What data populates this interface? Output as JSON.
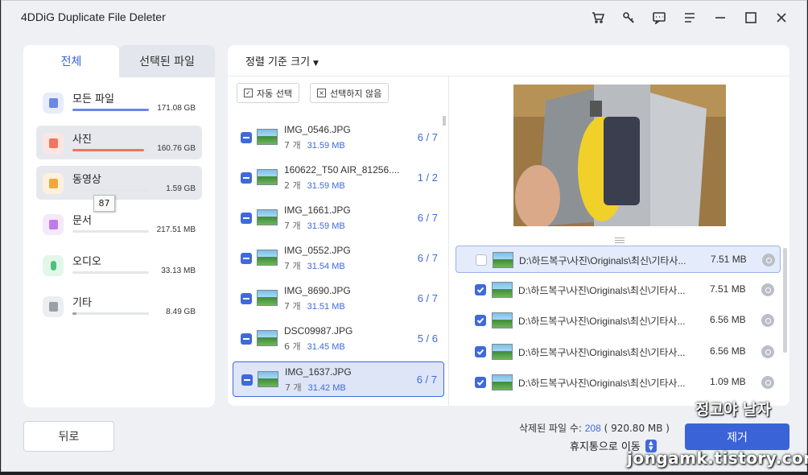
{
  "window": {
    "title": "4DDiG Duplicate File Deleter"
  },
  "left": {
    "tabs": [
      {
        "label": "전체"
      },
      {
        "label": "선택된 파일"
      }
    ],
    "categories": [
      {
        "label": "모든 파일",
        "size": "171.08 GB",
        "fill": 1.0,
        "color": "#6b87e6",
        "icon_bg": "#e7ecfb",
        "icon": "folder-icon"
      },
      {
        "label": "사진",
        "size": "160.76 GB",
        "fill": 0.94,
        "color": "#f0745f",
        "icon_bg": "#fde6e2",
        "icon": "image-icon"
      },
      {
        "label": "동영상",
        "size": "1.59 GB",
        "fill": 0.0,
        "color": "#f2a73a",
        "icon_bg": "#fdf0dc",
        "icon": "video-icon"
      },
      {
        "label": "문서",
        "size": "217.51 MB",
        "fill": 0.0,
        "color": "#c07ae8",
        "icon_bg": "#f4e9fb",
        "icon": "document-icon"
      },
      {
        "label": "오디오",
        "size": "33.13 MB",
        "fill": 0.0,
        "color": "#4cc27a",
        "icon_bg": "#e3f6ea",
        "icon": "audio-icon"
      },
      {
        "label": "기타",
        "size": "8.49 GB",
        "fill": 0.05,
        "color": "#9aa0a8",
        "icon_bg": "#eceef1",
        "icon": "other-icon"
      }
    ],
    "tooltip": "87"
  },
  "main": {
    "sort_label": "정렬 기준 크기",
    "auto_select": "자동 선택",
    "deselect": "선택하지 않음",
    "groups": [
      {
        "name": "IMG_0546.JPG",
        "count_text": "7 개",
        "size": "31.59 MB",
        "selected": "6",
        "total": "7"
      },
      {
        "name": "160622_T50 AIR_81256....",
        "count_text": "2 개",
        "size": "31.59 MB",
        "selected": "1",
        "total": "2"
      },
      {
        "name": "IMG_1661.JPG",
        "count_text": "7 개",
        "size": "31.59 MB",
        "selected": "6",
        "total": "7"
      },
      {
        "name": "IMG_0552.JPG",
        "count_text": "7 개",
        "size": "31.54 MB",
        "selected": "6",
        "total": "7"
      },
      {
        "name": "IMG_8690.JPG",
        "count_text": "7 개",
        "size": "31.51 MB",
        "selected": "6",
        "total": "7"
      },
      {
        "name": "DSC09987.JPG",
        "count_text": "6 개",
        "size": "31.45 MB",
        "selected": "5",
        "total": "6"
      },
      {
        "name": "IMG_1637.JPG",
        "count_text": "7 개",
        "size": "31.42 MB",
        "selected": "6",
        "total": "7"
      }
    ],
    "files": [
      {
        "path": "D:\\하드복구\\사진\\Originals\\최신\\기타사...",
        "size": "7.51 MB",
        "checked": false
      },
      {
        "path": "D:\\하드복구\\사진\\Originals\\최신\\기타사...",
        "size": "7.51 MB",
        "checked": true
      },
      {
        "path": "D:\\하드복구\\사진\\Originals\\최신\\기타사...",
        "size": "6.56 MB",
        "checked": true
      },
      {
        "path": "D:\\하드복구\\사진\\Originals\\최신\\기타사...",
        "size": "6.56 MB",
        "checked": true
      },
      {
        "path": "D:\\하드복구\\사진\\Originals\\최신\\기타사...",
        "size": "1.09 MB",
        "checked": true
      }
    ]
  },
  "footer": {
    "back_label": "뒤로",
    "deleted_prefix": "삭제된 파일 수: ",
    "deleted_count": "208",
    "deleted_size": "( 920.80 MB )",
    "trash_label": "휴지통으로 이동",
    "remove_label": "제거",
    "watermark_logo": "정고야 날자",
    "watermark_url": "jongamk.tistory.com"
  },
  "colors": {
    "accent": "#3f6ad8",
    "photo_bar": "#f0745f"
  }
}
